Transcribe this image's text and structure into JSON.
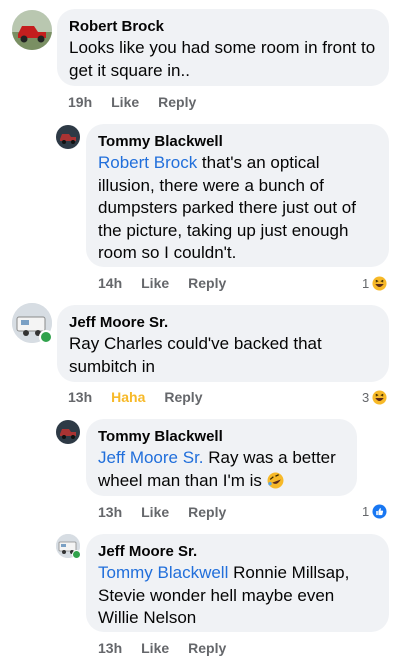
{
  "comments": [
    {
      "author": "Robert Brock",
      "mention": "",
      "text": "Looks like you had some room in front to get it square in..",
      "time": "19h",
      "like_label": "Like",
      "reply_label": "Reply",
      "reaction_count": "",
      "reaction_icon": ""
    },
    {
      "author": "Tommy Blackwell",
      "mention": "Robert Brock",
      "text": " that's an optical illusion, there were a bunch of dumpsters parked there just out of the picture, taking up just enough room so I couldn't.",
      "time": "14h",
      "like_label": "Like",
      "reply_label": "Reply",
      "reaction_count": "1",
      "reaction_icon": "haha-emoji-icon"
    },
    {
      "author": "Jeff Moore Sr.",
      "mention": "",
      "text": "Ray Charles could've backed that sumbitch in",
      "time": "13h",
      "like_label": "Haha",
      "reply_label": "Reply",
      "reaction_count": "3",
      "reaction_icon": "haha-emoji-icon"
    },
    {
      "author": "Tommy Blackwell",
      "mention": "Jeff Moore Sr.",
      "text": " Ray was a better wheel man than I'm is ",
      "inline_emoji": "rolling-laughing-emoji-icon",
      "time": "13h",
      "like_label": "Like",
      "reply_label": "Reply",
      "reaction_count": "1",
      "reaction_icon": "like-thumb-icon"
    },
    {
      "author": "Jeff Moore Sr.",
      "mention": "Tommy Blackwell",
      "text": " Ronnie Millsap, Stevie wonder hell maybe even Willie Nelson",
      "time": "13h",
      "like_label": "Like",
      "reply_label": "Reply",
      "reaction_count": "",
      "reaction_icon": ""
    }
  ],
  "colors": {
    "bubble": "#f0f2f5",
    "mention": "#216fdb",
    "meta": "#65676b",
    "haha": "#f7b928",
    "like": "#1877f2",
    "online": "#31a24c"
  }
}
